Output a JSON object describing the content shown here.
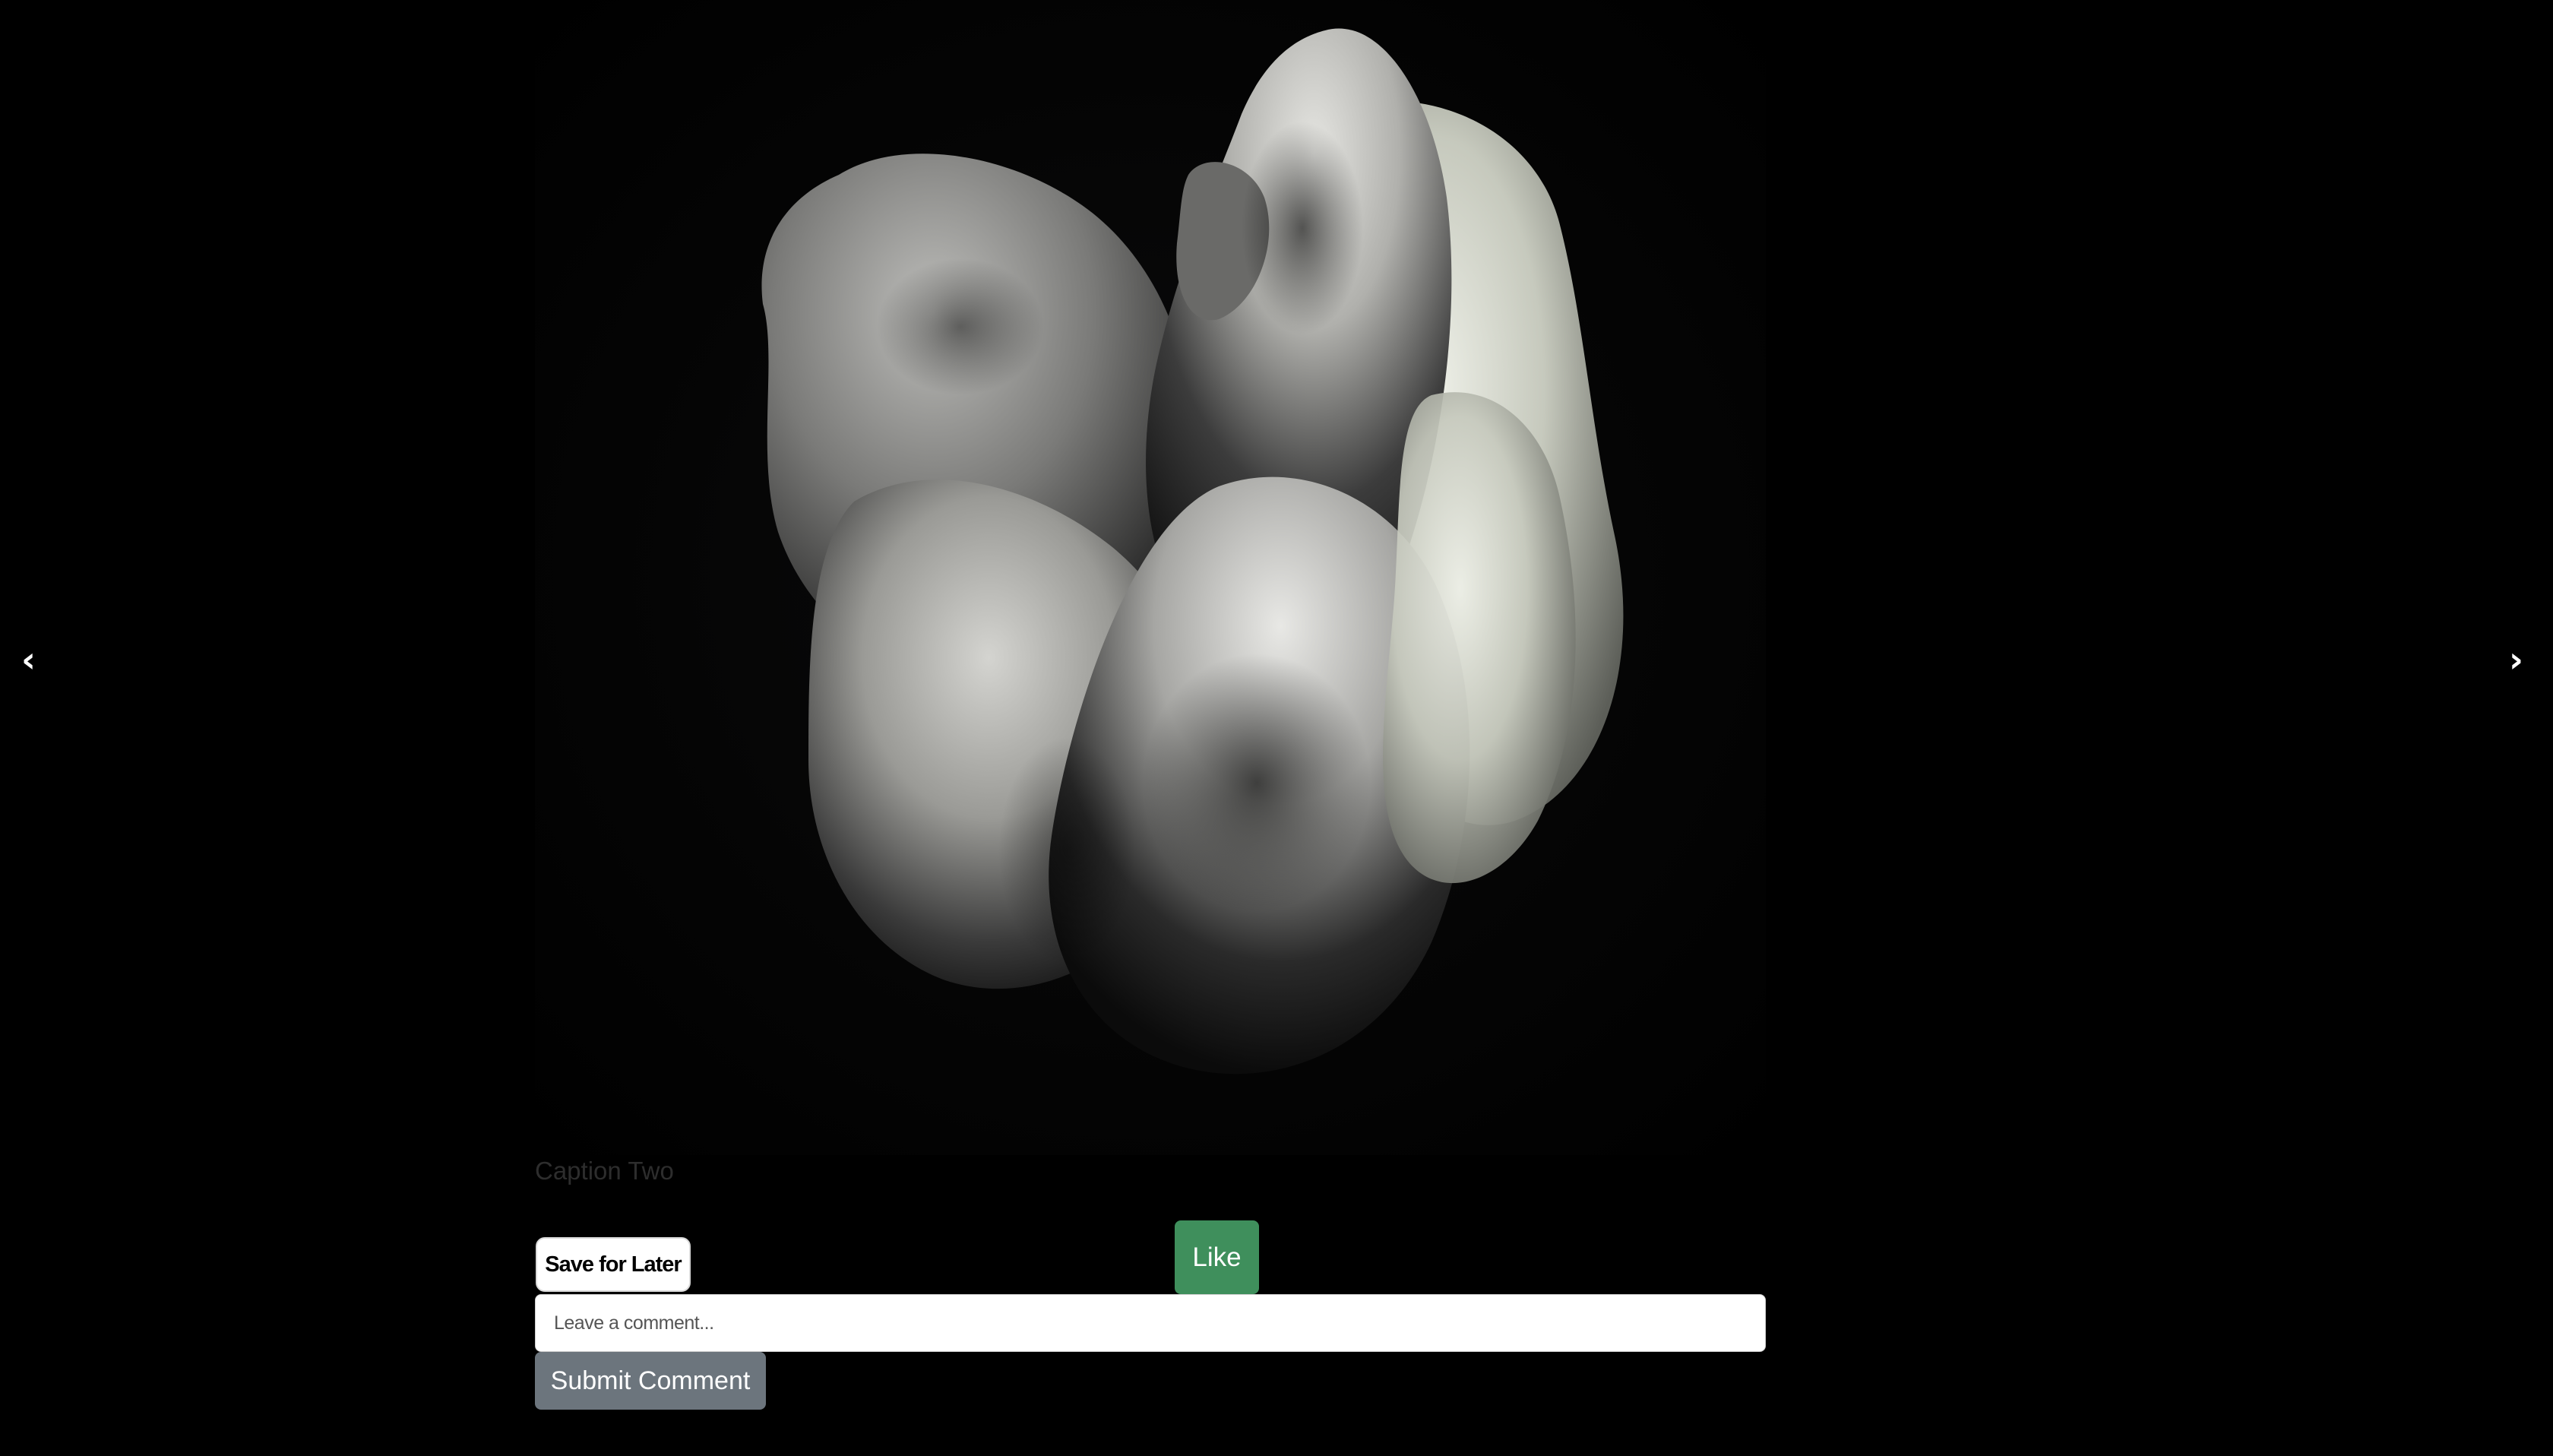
{
  "gallery": {
    "prev_arrow": "‹",
    "next_arrow": "›",
    "caption": "Caption Two",
    "image_icon": "abstract-sculpture-image"
  },
  "actions": {
    "save_label": "Save for Later",
    "like_label": "Like",
    "comment_placeholder": "Leave a comment...",
    "submit_label": "Submit Comment"
  },
  "colors": {
    "background": "#000000",
    "like_button": "#3f8f5c",
    "submit_button": "#6c757d",
    "caption_text": "#2d2d2d"
  }
}
